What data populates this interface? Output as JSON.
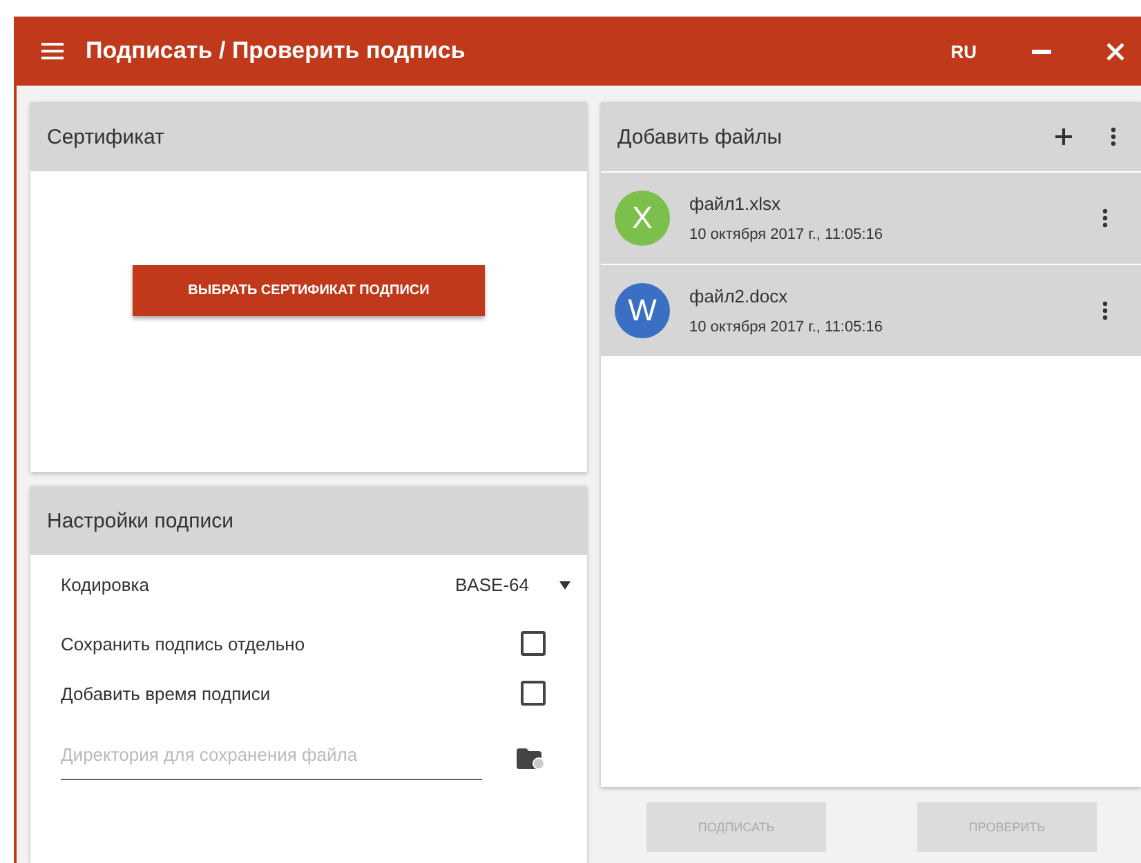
{
  "window": {
    "title": "Подписать / Проверить подпись",
    "language": "RU"
  },
  "certificate": {
    "title": "Сертификат",
    "button": "ВЫБРАТЬ СЕРТИФИКАТ ПОДПИСИ"
  },
  "settings": {
    "title": "Настройки подписи",
    "encoding": {
      "label": "Кодировка",
      "value": "BASE-64"
    },
    "options": [
      {
        "label": "Сохранить подпись отдельно",
        "checked": false
      },
      {
        "label": "Добавить время подписи",
        "checked": false
      }
    ],
    "directory": {
      "placeholder": "Директория для сохранения файла"
    }
  },
  "files": {
    "title": "Добавить файлы",
    "items": [
      {
        "letter": "X",
        "color": "#7cc04b",
        "name": "файл1.xlsx",
        "date": "10 октября 2017 г., 11:05:16"
      },
      {
        "letter": "W",
        "color": "#3a6fc4",
        "name": "файл2.docx",
        "date": "10 октября 2017 г., 11:05:16"
      }
    ]
  },
  "actions": [
    {
      "label": "ПОДПИСАТЬ",
      "disabled": true
    },
    {
      "label": "ПРОВЕРИТЬ",
      "disabled": true
    }
  ]
}
